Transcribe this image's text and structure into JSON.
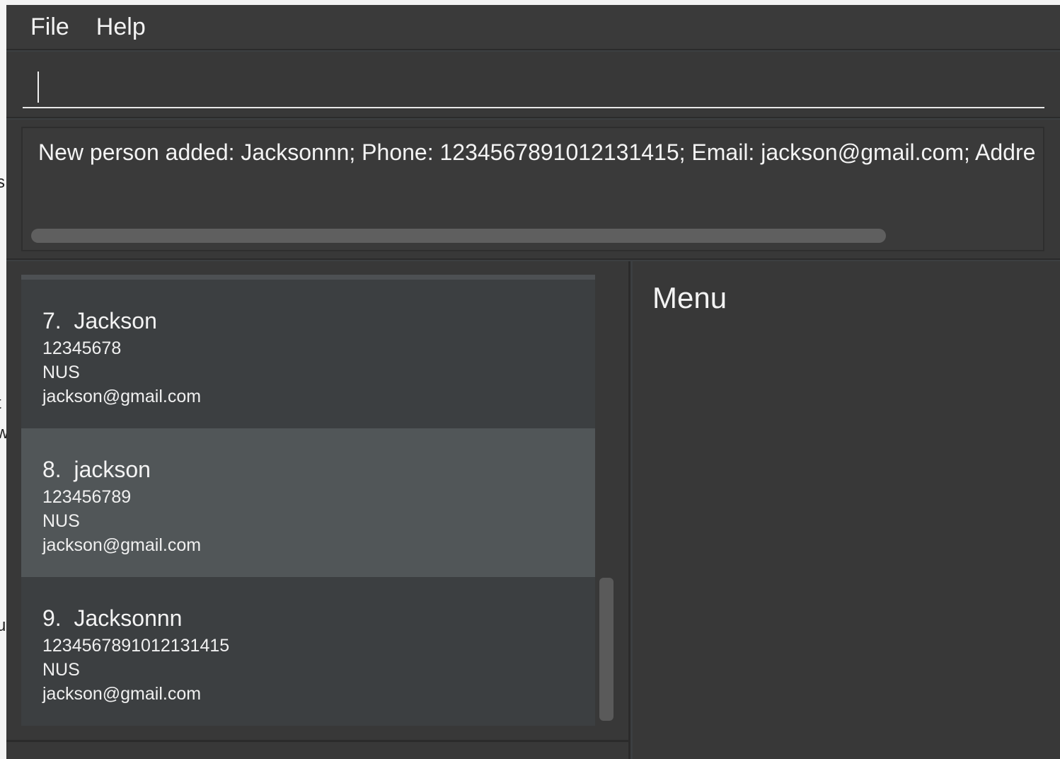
{
  "menubar": {
    "items": [
      "File",
      "Help"
    ]
  },
  "command": {
    "value": "",
    "placeholder": ""
  },
  "result": {
    "text": "New person added: Jacksonnn; Phone: 1234567891012131415; Email: jackson@gmail.com; Addre"
  },
  "persons": [
    {
      "index": "7.",
      "name": "Jackson",
      "phone": "12345678",
      "address": "NUS",
      "email": "jackson@gmail.com",
      "selected": false
    },
    {
      "index": "8.",
      "name": "jackson",
      "phone": "123456789",
      "address": "NUS",
      "email": "jackson@gmail.com",
      "selected": true
    },
    {
      "index": "9.",
      "name": "Jacksonnn",
      "phone": "1234567891012131415",
      "address": "NUS",
      "email": "jackson@gmail.com",
      "selected": false
    }
  ],
  "menu_panel": {
    "title": "Menu"
  },
  "background_window": {
    "fragments": [
      "s",
      "t",
      "w",
      "u"
    ]
  },
  "colors": {
    "background": "#3c3f41",
    "selected_row": "#515658",
    "text": "#f3f3f3"
  }
}
